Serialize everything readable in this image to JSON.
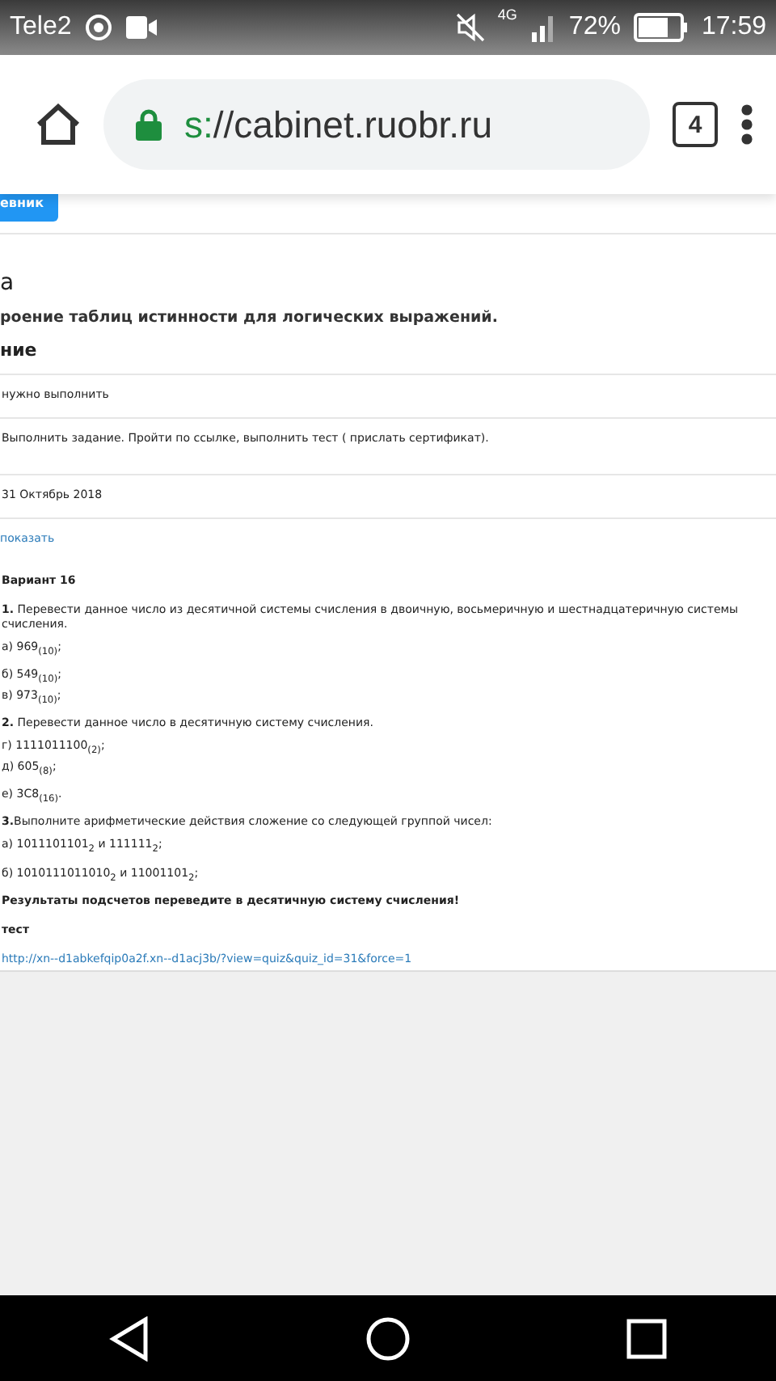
{
  "status_bar": {
    "carrier": "Tele2",
    "network": "4G",
    "battery": "72%",
    "time": "17:59"
  },
  "browser": {
    "url_scheme": "s:",
    "url_host": "//cabinet.ruobr.ru",
    "tab_count": "4"
  },
  "page": {
    "top_button": "евник",
    "title": "а",
    "subtitle": "роение таблиц истинности для логических выражений.",
    "section": "ние",
    "rows": [
      "нужно выполнить",
      "Выполнить задание. Пройти по ссылке, выполнить тест ( прислать сертификат).",
      "31 Октябрь 2018"
    ],
    "show_link": "показать",
    "content": [
      {
        "kind": "heading",
        "text": "Вариант 16"
      },
      {
        "kind": "para",
        "text": "**1.** Перевести данное число из десятичной системы счисления в двоичную, восьмеричную и шестнадцатеричную системы счисления."
      },
      {
        "kind": "para",
        "text": "а) 969$_{(10)}$;"
      },
      {
        "kind": "tight",
        "text": "б) 549$_{(10)}$;"
      },
      {
        "kind": "para",
        "text": "в) 973$_{(10)}$;"
      },
      {
        "kind": "para",
        "text": "**2.** Перевести данное число в десятичную систему счисления."
      },
      {
        "kind": "tight",
        "text": "г) 1111011100$_{(2)}$;"
      },
      {
        "kind": "para",
        "text": "д) 605$_{(8)}$;"
      },
      {
        "kind": "para",
        "text": " е) 3C8$_{(16)}$."
      },
      {
        "kind": "para",
        "text": "**3.**Выполните арифметические действия сложение со следующей группой чисел:"
      },
      {
        "kind": "para",
        "text": "а) 1011101101$_{2}$ и 111111$_{2}$;"
      },
      {
        "kind": "para",
        "text": "б) 1010111011010$_{2}$ и 11001101$_{2}$;"
      },
      {
        "kind": "heading",
        "text": "Результаты подсчетов переведите в десятичную систему счисления!"
      },
      {
        "kind": "heading",
        "text": "тест"
      },
      {
        "kind": "link",
        "text": "http://xn--d1abkefqip0a2f.xn--d1acj3b/?view=quiz&quiz_id=31&force=1"
      }
    ]
  }
}
